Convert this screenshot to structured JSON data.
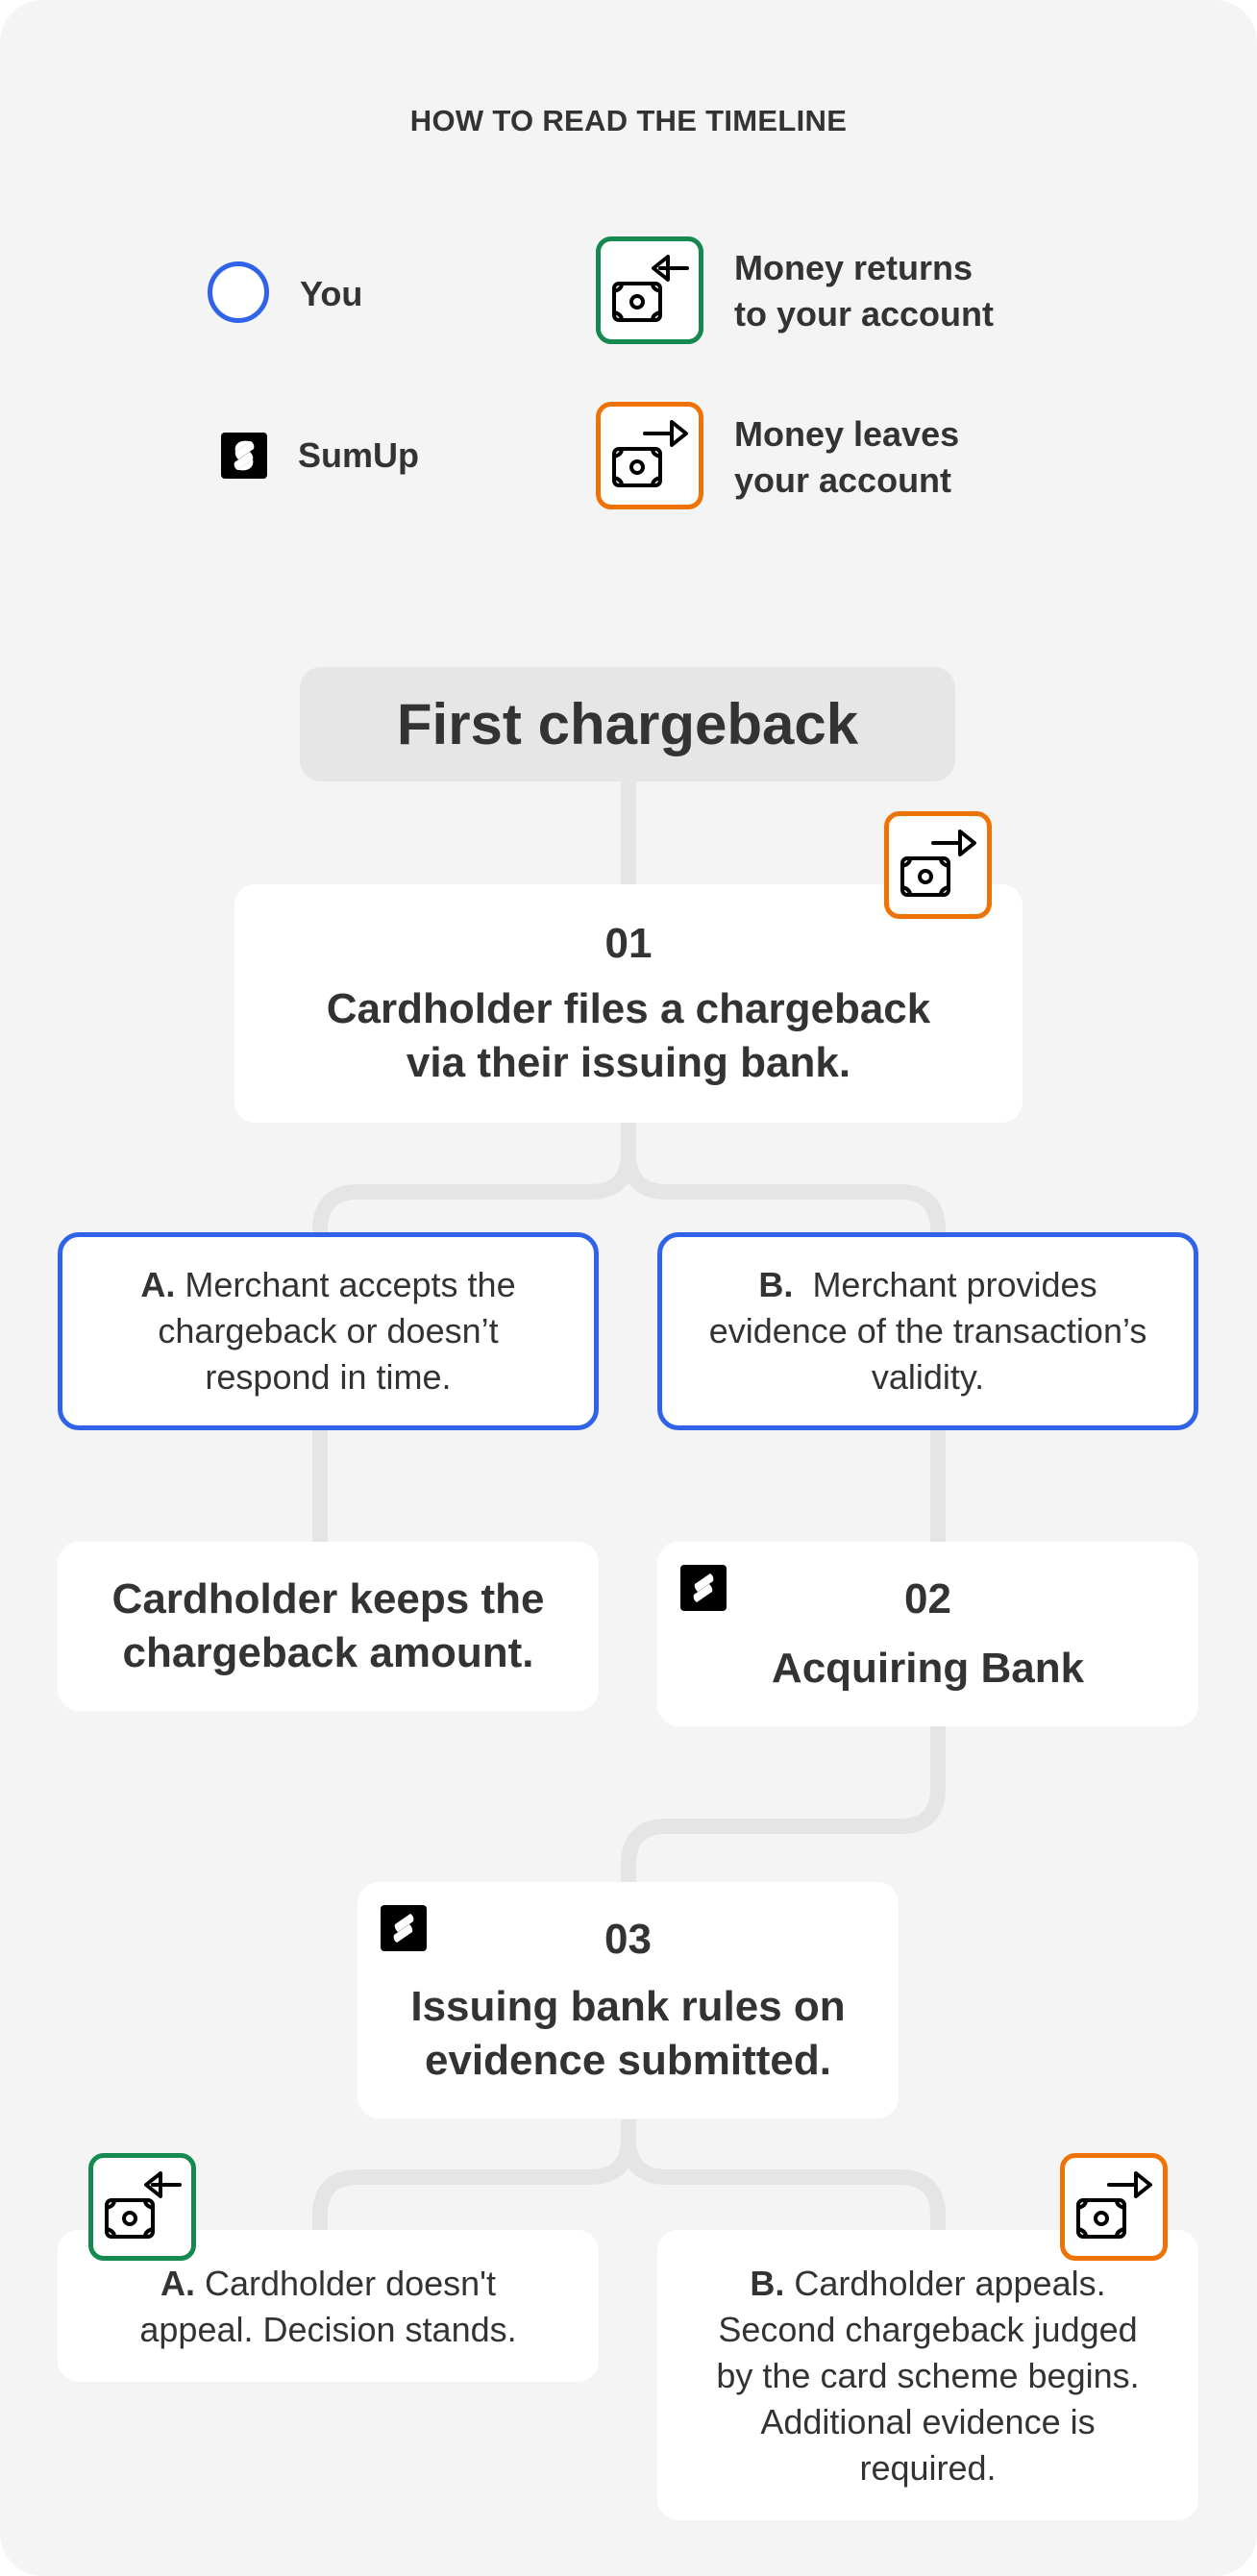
{
  "legend": {
    "title": "HOW TO READ THE TIMELINE",
    "items": [
      {
        "icon": "you-circle-icon",
        "label": "You",
        "color": "#3063e9"
      },
      {
        "icon": "sumup-logo-icon",
        "label": "SumUp",
        "color": "#000000"
      },
      {
        "icon": "money-in-icon",
        "label_line1": "Money returns",
        "label_line2": "to your account",
        "color": "#15894f"
      },
      {
        "icon": "money-out-icon",
        "label_line1": "Money leaves",
        "label_line2": "your account",
        "color": "#ee7205"
      }
    ]
  },
  "section": {
    "title": "First chargeback"
  },
  "steps": [
    {
      "number": "01",
      "line1": "Cardholder files a chargeback",
      "line2": "via their issuing bank.",
      "money_icon": "money-out-icon"
    },
    {
      "number": "02",
      "line1": "Acquiring Bank",
      "actor_icon": "sumup-logo-icon"
    },
    {
      "number": "03",
      "line1": "Issuing bank rules on",
      "line2": "evidence submitted.",
      "actor_icon": "sumup-logo-icon"
    }
  ],
  "branch1": {
    "a": {
      "prefix": "A.",
      "line1": "Merchant accepts the",
      "line2": "chargeback or doesn’t",
      "line3": "respond in time.",
      "actor": "You"
    },
    "b": {
      "prefix": "B.",
      "line1": "Merchant provides",
      "line2": "evidence of the transaction’s",
      "line3": "validity.",
      "actor": "You"
    },
    "a_outcome": {
      "line1": "Cardholder keeps the",
      "line2": "chargeback amount."
    }
  },
  "branch2": {
    "a": {
      "prefix": "A.",
      "line1": "Cardholder doesn't",
      "line2": "appeal. Decision stands.",
      "money_icon": "money-in-icon"
    },
    "b": {
      "prefix": "B.",
      "line1": "Cardholder appeals.",
      "line2": "Second chargeback judged",
      "line3": "by the card scheme begins.",
      "line4": "Additional evidence is",
      "line5": "required.",
      "money_icon": "money-out-icon"
    }
  },
  "colors": {
    "you": "#3063e9",
    "money_in": "#15894f",
    "money_out": "#ee7205",
    "connector": "#e5e5e5",
    "background": "#f4f4f4",
    "text": "#333333"
  }
}
